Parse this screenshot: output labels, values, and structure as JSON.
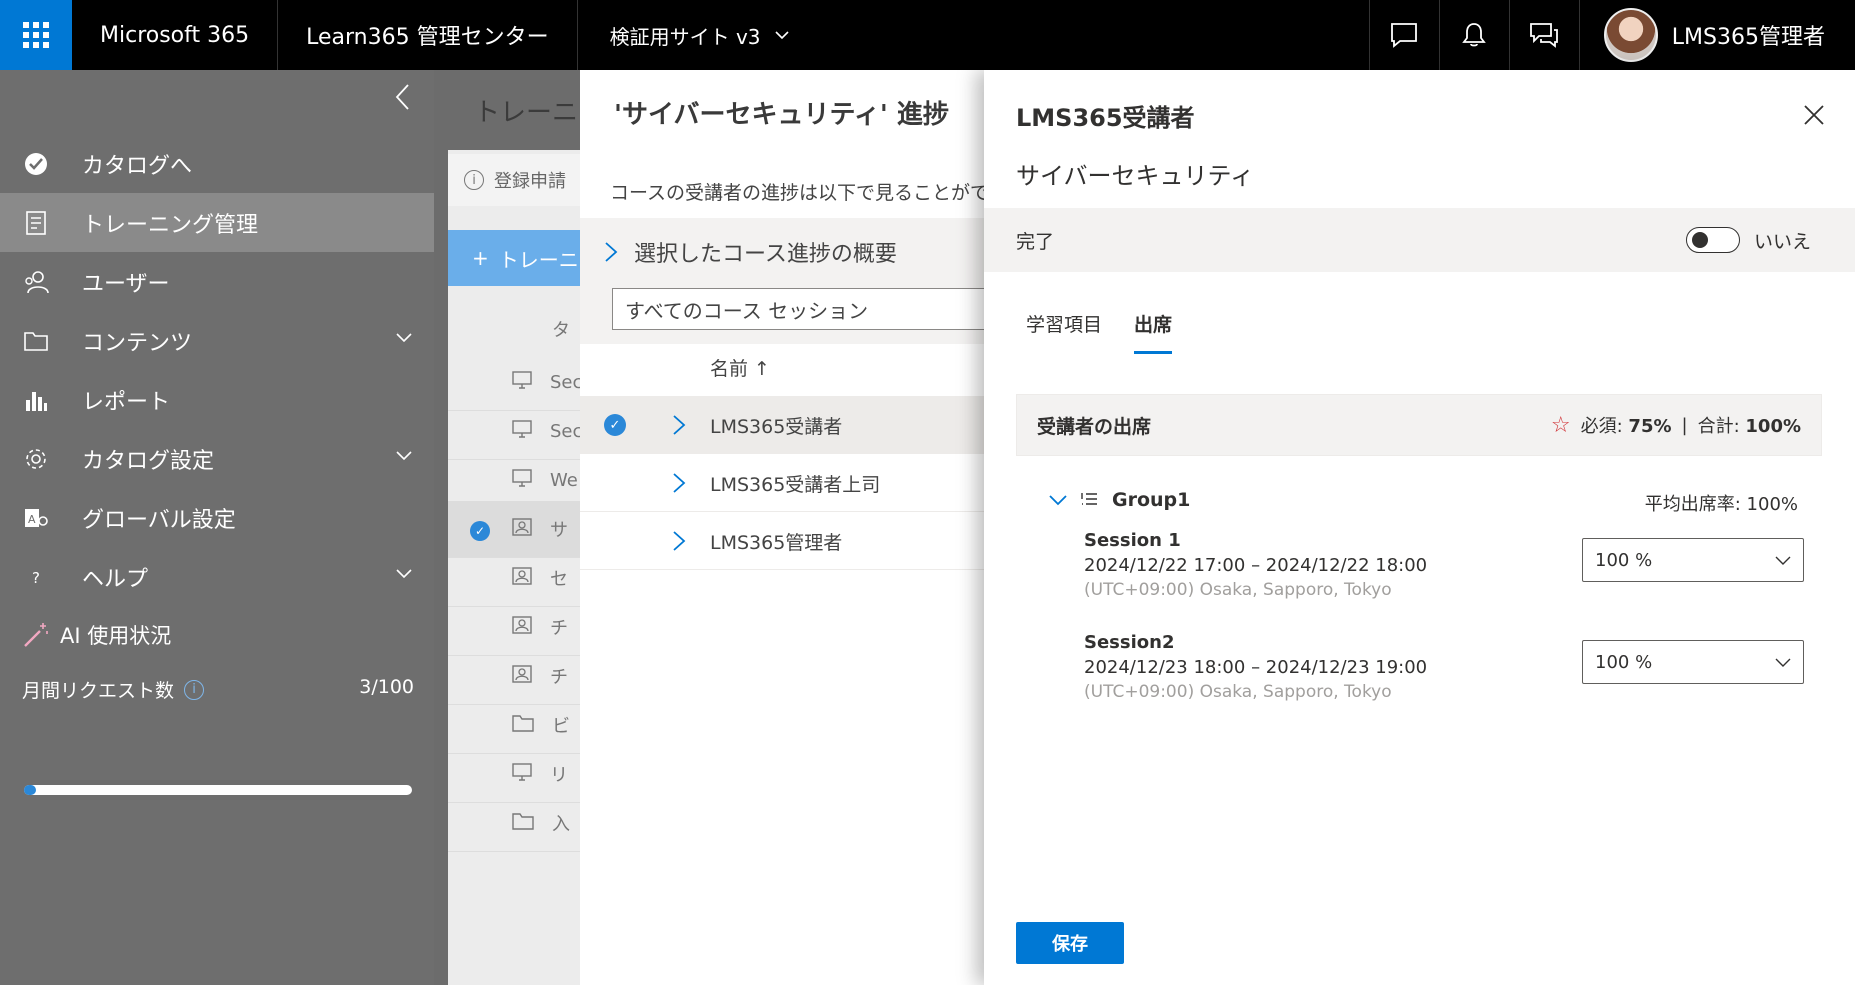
{
  "topbar": {
    "app_name": "Microsoft 365",
    "admin_center": "Learn365 管理センター",
    "site_selector": "検証用サイト v3",
    "user_name": "LMS365管理者"
  },
  "leftnav": {
    "items": [
      {
        "label": "カタログへ",
        "icon": "check-circle-icon"
      },
      {
        "label": "トレーニング管理",
        "icon": "clipboard-icon",
        "active": true
      },
      {
        "label": "ユーザー",
        "icon": "users-icon"
      },
      {
        "label": "コンテンツ",
        "icon": "folder-icon",
        "expandable": true
      },
      {
        "label": "レポート",
        "icon": "bar-chart-icon"
      },
      {
        "label": "カタログ設定",
        "icon": "gear-icon",
        "expandable": true
      },
      {
        "label": "グローバル設定",
        "icon": "admin-settings-icon"
      },
      {
        "label": "ヘルプ",
        "icon": "question-icon",
        "expandable": true
      }
    ],
    "ai_usage_label": "AI 使用状況",
    "monthly_requests_label": "月間リクエスト数",
    "monthly_requests_value": "3/100",
    "monthly_requests_fraction": 0.03
  },
  "background": {
    "title": "トレーニン",
    "info_text": "登録申請",
    "add_button": "トレーニ",
    "column_header": "タ",
    "rows": [
      {
        "text": "Sec",
        "icon": "monitor-icon"
      },
      {
        "text": "Sec",
        "icon": "monitor-icon"
      },
      {
        "text": "We",
        "icon": "monitor-icon"
      },
      {
        "text": "サ",
        "icon": "classroom-icon",
        "selected": true
      },
      {
        "text": "セ",
        "icon": "classroom-icon"
      },
      {
        "text": "チ",
        "icon": "classroom-icon"
      },
      {
        "text": "チ",
        "icon": "classroom-icon"
      },
      {
        "text": "ビ",
        "icon": "folder-icon"
      },
      {
        "text": "リ",
        "icon": "monitor-icon"
      },
      {
        "text": "入",
        "icon": "folder-icon"
      }
    ]
  },
  "middle": {
    "title": "'サイバーセキュリティ' 進捗",
    "description": "コースの受講者の進捗は以下で見ることがで",
    "summary": "選択したコース進捗の概要",
    "session_filter": "すべてのコース セッション",
    "name_header": "名前 ↑",
    "rows": [
      {
        "name": "LMS365受講者",
        "selected": true
      },
      {
        "name": "LMS365受講者上司",
        "selected": false
      },
      {
        "name": "LMS365管理者",
        "selected": false
      }
    ]
  },
  "panel": {
    "title": "LMS365受講者",
    "subtitle": "サイバーセキュリティ",
    "complete_label": "完了",
    "complete_toggle_label": "いいえ",
    "tabs": [
      {
        "label": "学習項目",
        "active": false
      },
      {
        "label": "出席",
        "active": true
      }
    ],
    "attendance": {
      "title": "受講者の出席",
      "required_label": "必須: ",
      "required_value": "75%",
      "separator": "|",
      "total_label": "合計: ",
      "total_value": "100%"
    },
    "group": {
      "name": "Group1",
      "avg_rate": "平均出席率: 100%"
    },
    "sessions": [
      {
        "name": "Session 1",
        "time": "2024/12/22 17:00 – 2024/12/22 18:00",
        "timezone": "(UTC+09:00) Osaka, Sapporo, Tokyo",
        "attendance": "100 %"
      },
      {
        "name": "Session2",
        "time": "2024/12/23 18:00 – 2024/12/23 19:00",
        "timezone": "(UTC+09:00) Osaka, Sapporo, Tokyo",
        "attendance": "100 %"
      }
    ],
    "save_button": "保存"
  },
  "colors": {
    "accent": "#0078d4",
    "topbar": "#000000",
    "nav_bg": "#6e6e6e",
    "required_star": "#d13438"
  }
}
